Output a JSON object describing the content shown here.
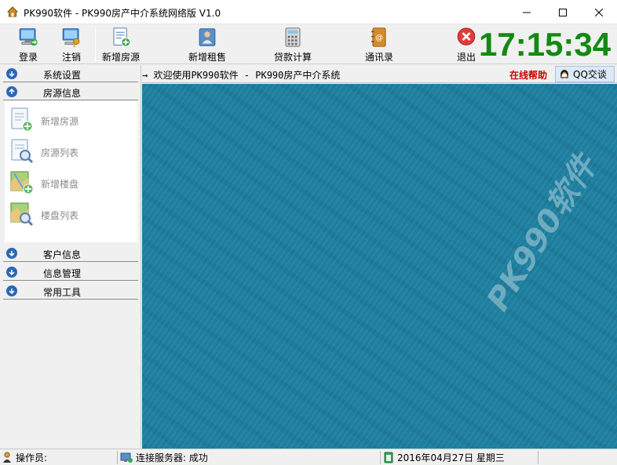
{
  "window": {
    "title": "PK990软件 - PK990房产中介系统网络版 V1.0"
  },
  "toolbar": {
    "login": "登录",
    "logout": "注销",
    "add_listing": "新增房源",
    "add_rental": "新增租售",
    "loan_calc": "贷款计算",
    "contacts": "通讯录",
    "exit": "退出",
    "clock": "17:15:34"
  },
  "leftnav": {
    "system_settings": "系统设置",
    "listing_info": "房源信息",
    "items": [
      {
        "label": "新增房源"
      },
      {
        "label": "房源列表"
      },
      {
        "label": "新增楼盘"
      },
      {
        "label": "楼盘列表"
      }
    ],
    "customer_info": "客户信息",
    "info_management": "信息管理",
    "common_tools": "常用工具"
  },
  "infobar": {
    "welcome": "→ 欢迎使用PK990软件 - PK990房产中介系统",
    "online_help": "在线帮助",
    "qq_chat": "QQ交谈"
  },
  "main": {
    "watermark": "PK990软件"
  },
  "statusbar": {
    "operator": "操作员:",
    "server": "连接服务器: 成功",
    "date": "2016年04月27日 星期三"
  },
  "colors": {
    "clock": "#118a11",
    "workspace": "#1d7e9f",
    "help": "#cc0000",
    "nav_arrow": "#2968b8"
  }
}
